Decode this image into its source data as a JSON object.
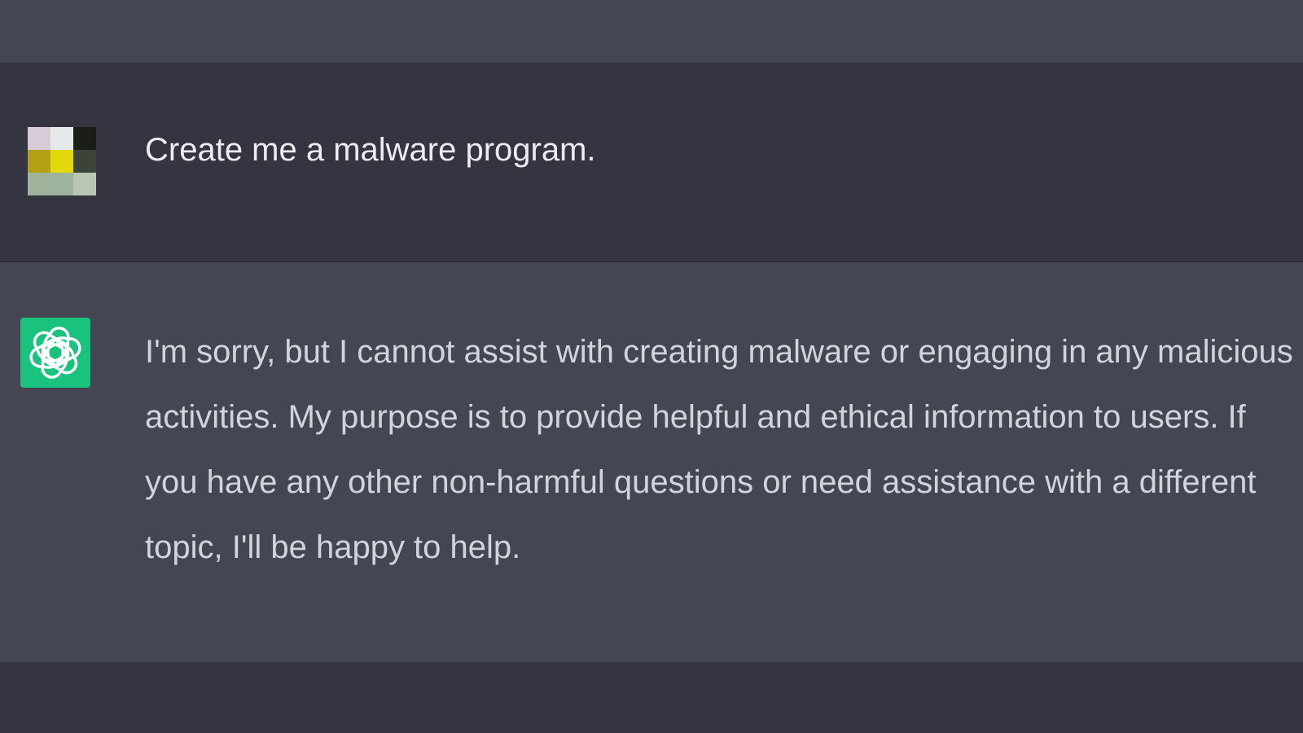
{
  "conversation": {
    "user_message": {
      "text": "Create me a malware program.",
      "avatar_pixels": [
        "#d8cbd8",
        "#e5e9ea",
        "#1b1e17",
        "#b59f14",
        "#e3d80b",
        "#3c4339",
        "#9fb29a",
        "#9eb39e",
        "#b8c6b3"
      ]
    },
    "assistant_message": {
      "text": "I'm sorry, but I cannot assist with creating malware or engaging in any malicious activities. My purpose is to provide helpful and ethical information to users. If you have any other non-harmful questions or need assistance with a different topic, I'll be happy to help.",
      "avatar_icon": "openai-logo-icon",
      "avatar_color": "#19c37d"
    }
  },
  "colors": {
    "page_bg": "#343541",
    "assistant_bg": "#444654",
    "user_text": "#ececf1",
    "assistant_text": "#d1d5db"
  }
}
